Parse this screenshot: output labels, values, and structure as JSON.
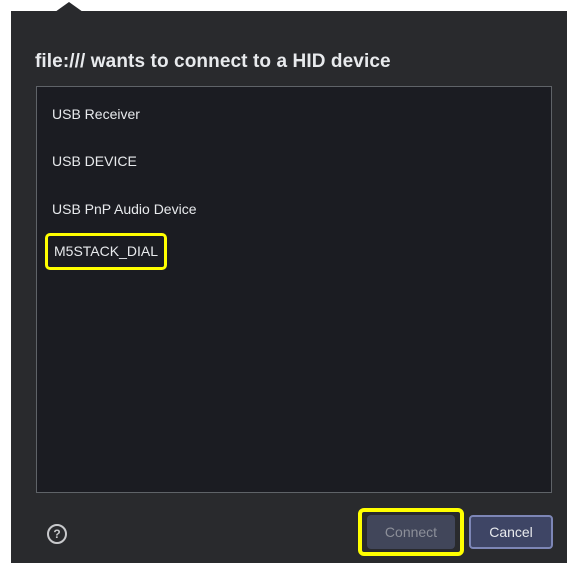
{
  "dialog": {
    "title": "file:/// wants to connect to a HID device",
    "devices": [
      {
        "label": "USB Receiver",
        "highlighted": false
      },
      {
        "label": "USB DEVICE",
        "highlighted": false
      },
      {
        "label": "USB PnP Audio Device",
        "highlighted": false
      },
      {
        "label": "M5STACK_DIAL",
        "highlighted": true
      }
    ],
    "help_icon": "help-circle-icon",
    "help_glyph": "?",
    "buttons": {
      "connect": "Connect",
      "cancel": "Cancel"
    }
  },
  "colors": {
    "dialog_background": "#292a2d",
    "list_background": "#1b1c22",
    "highlight": "#ffff00",
    "cancel_button": "#3e4565"
  }
}
